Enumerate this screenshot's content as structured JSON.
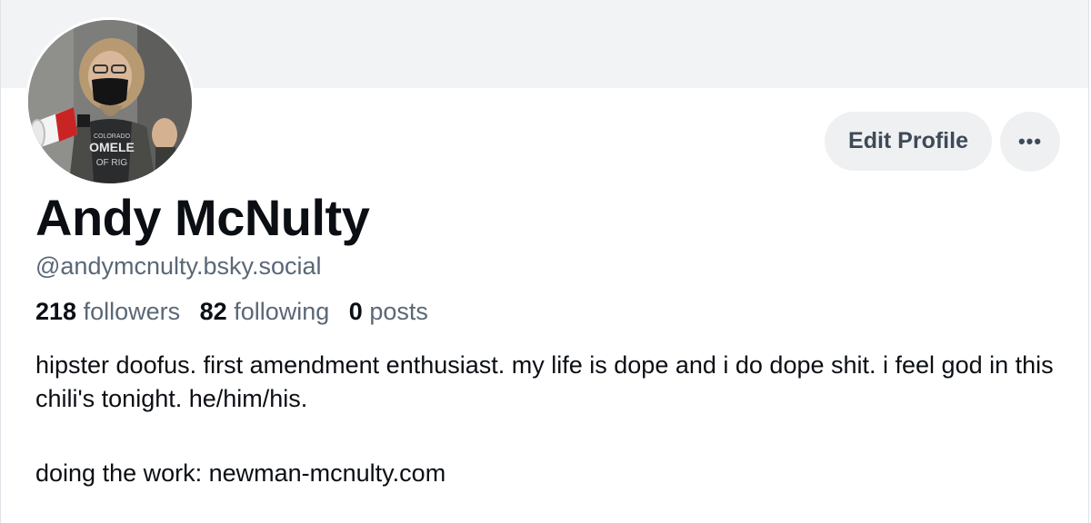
{
  "profile": {
    "display_name": "Andy McNulty",
    "handle": "@andymcnulty.bsky.social",
    "avatar": {
      "icon": "profile-photo",
      "shirt_text": [
        "COLORADO",
        "OMELE",
        "OF RIG"
      ]
    },
    "stats": {
      "followers_count": "218",
      "followers_label": "followers",
      "following_count": "82",
      "following_label": "following",
      "posts_count": "0",
      "posts_label": "posts"
    },
    "bio": {
      "line1": "hipster doofus. first amendment enthusiast. my life is dope and i do dope shit. i feel god in this chili's tonight. he/him/his.",
      "line2": "doing the work: newman-mcnulty.com"
    }
  },
  "actions": {
    "edit_profile_label": "Edit Profile",
    "more_icon": "more-horizontal-icon",
    "more_label": "•••"
  },
  "colors": {
    "banner": "#f1f3f5",
    "button_bg": "#eef0f2",
    "button_text": "#3e4a57",
    "muted_text": "#5a6776",
    "primary_text": "#0b0f14"
  }
}
